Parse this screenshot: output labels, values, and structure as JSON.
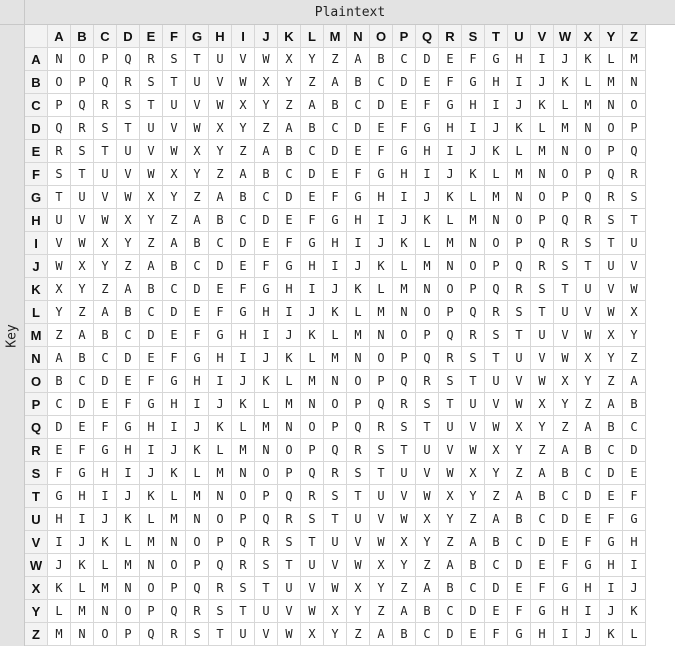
{
  "column_header": "Plaintext",
  "row_header": "Key",
  "alphabet": [
    "A",
    "B",
    "C",
    "D",
    "E",
    "F",
    "G",
    "H",
    "I",
    "J",
    "K",
    "L",
    "M",
    "N",
    "O",
    "P",
    "Q",
    "R",
    "S",
    "T",
    "U",
    "V",
    "W",
    "X",
    "Y",
    "Z"
  ],
  "table": [
    "NOPQRSTUVWXYZABCDEFGHIJKLM",
    "OPQRSTUVWXYZABCDEFGHIJKLMN",
    "PQRSTUVWXYZABCDEFGHIJKLMNO",
    "QRSTUVWXYZABCDEFGHIJKLMNOP",
    "RSTUVWXYZABCDEFGHIJKLMNOPQ",
    "STUVWXYZABCDEFGHIJKLMNOPQR",
    "TUVWXYZABCDEFGHIJKLMNOPQRS",
    "UVWXYZABCDEFGHIJKLMNOPQRST",
    "VWXYZABCDEFGHIJKLMNOPQRSTU",
    "WXYZABCDEFGHIJKLMNOPQRSTUV",
    "XYZABCDEFGHIJKLMNOPQRSTUVW",
    "YZABCDEFGHIJKLMNOPQRSTUVWX",
    "ZABCDEFGHIJKLMNOPQRSTUVWXY",
    "ABCDEFGHIJKLMNOPQRSTUVWXYZ",
    "BCDEFGHIJKLMNOPQRSTUVWXYZA",
    "CDEFGHIJKLMNOPQRSTUVWXYZAB",
    "DEFGHIJKLMNOPQRSTUVWXYZABC",
    "EFGHIJKLMNOPQRSTUVWXYZABCD",
    "FGHIJKLMNOPQRSTUVWXYZABCDE",
    "GHIJKLMNOPQRSTUVWXYZABCDEF",
    "HIJKLMNOPQRSTUVWXYZABCDEFG",
    "IJKLMNOPQRSTUVWXYZABCDEFGH",
    "JKLMNOPQRSTUVWXYZABCDEFGHI",
    "KLMNOPQRSTUVWXYZABCDEFGHIJ",
    "LMNOPQRSTUVWXYZABCDEFGHIJK",
    "MNOPQRSTUVWXYZABCDEFGHIJKL"
  ]
}
